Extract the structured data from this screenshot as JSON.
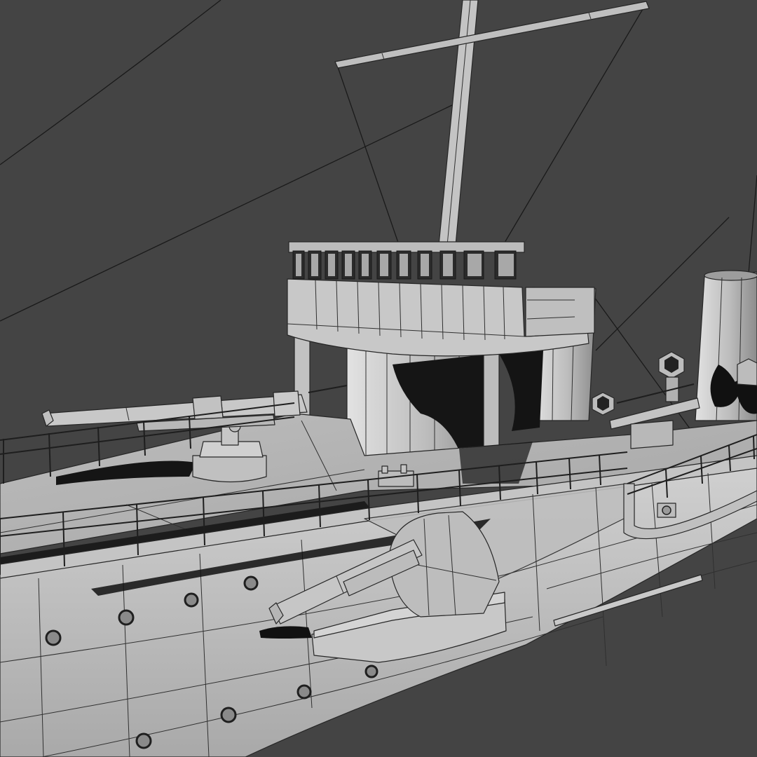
{
  "scene": {
    "background_color": "#444444",
    "surface_light": "#c9c9c9",
    "surface_mid": "#b3b3b3",
    "surface_dark": "#9a9a9a",
    "shadow_color": "#111111",
    "wire_color": "#1a1a1a",
    "render_style": "untextured shaded viewport with visible edge wireframe",
    "subject_elements": [
      "mast-icon",
      "bridge-icon",
      "deck-gun-icon",
      "casemate-gun-icon",
      "funnel-icon",
      "hull-icon",
      "railing-icon",
      "porthole-icon",
      "rigging-icon",
      "ventilator-icon"
    ]
  }
}
